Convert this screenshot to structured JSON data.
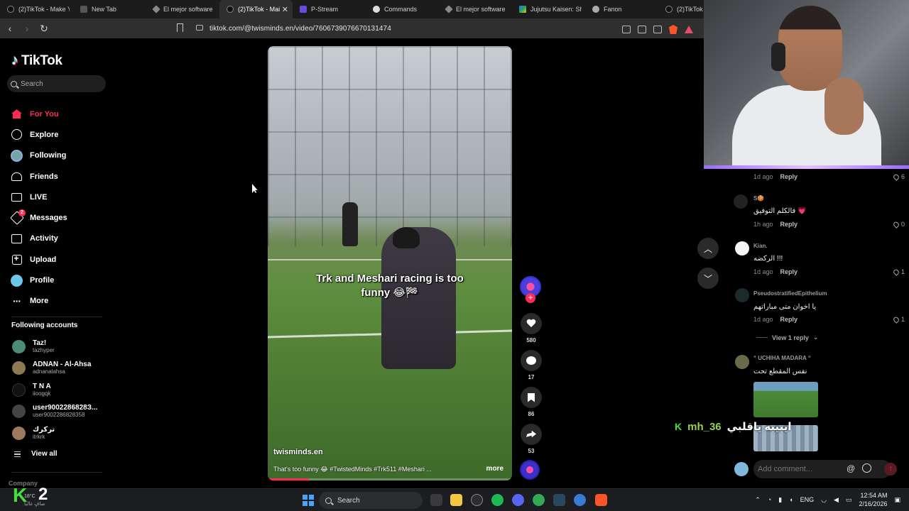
{
  "browser": {
    "tabs": [
      {
        "title": "(2)TikTok - Make Yo",
        "favicon": "tiktok-icon",
        "active": false
      },
      {
        "title": "New Tab",
        "favicon": "shield-icon",
        "active": false
      },
      {
        "title": "El mejor software p",
        "favicon": "diamond-icon",
        "active": false
      },
      {
        "title": "(2)TikTok - Mai",
        "favicon": "tiktok-icon",
        "active": true
      },
      {
        "title": "P-Stream",
        "favicon": "pstream-icon",
        "active": false
      },
      {
        "title": "Commands",
        "favicon": "discord-icon",
        "active": false
      },
      {
        "title": "El mejor software p",
        "favicon": "diamond-icon",
        "active": false
      },
      {
        "title": "Jujutsu Kaisen: Shin",
        "favicon": "drive-icon",
        "active": false
      },
      {
        "title": "Fanon",
        "favicon": "fanon-icon",
        "active": false
      },
      {
        "title": "(2)TikTok",
        "favicon": "tiktok-icon",
        "active": false
      }
    ],
    "url": "tiktok.com/@twisminds.en/video/7606739076670131474"
  },
  "sidebar": {
    "brand": "TikTok",
    "search_placeholder": "Search",
    "nav": [
      {
        "label": "For You",
        "icon": "home-icon",
        "active": true
      },
      {
        "label": "Explore",
        "icon": "compass-icon"
      },
      {
        "label": "Following",
        "icon": "following-avatar-icon"
      },
      {
        "label": "Friends",
        "icon": "friends-icon"
      },
      {
        "label": "LIVE",
        "icon": "live-icon"
      },
      {
        "label": "Messages",
        "icon": "messages-icon",
        "badge": "2"
      },
      {
        "label": "Activity",
        "icon": "activity-icon"
      },
      {
        "label": "Upload",
        "icon": "upload-icon"
      },
      {
        "label": "Profile",
        "icon": "profile-icon"
      },
      {
        "label": "More",
        "icon": "more-icon"
      }
    ],
    "following_title": "Following accounts",
    "accounts": [
      {
        "name": "Taz!",
        "handle": "tazhyper",
        "color": "#4a8c74"
      },
      {
        "name": "ADNAN - Al-Ahsa",
        "handle": "adnanalahsa",
        "color": "#8d7a52"
      },
      {
        "name": "T N A",
        "handle": "iioogqk",
        "color": "#111111"
      },
      {
        "name": "user9002286828З...",
        "handle": "user9002286828358",
        "color": "#444444"
      },
      {
        "name": "تركرك",
        "handle": "itrkrk",
        "color": "#9c7a5c"
      }
    ],
    "view_all": "View all",
    "company": "Company"
  },
  "video": {
    "caption": "Trk and Meshari racing is too funny 😂🏁",
    "author": "twisminds.en",
    "description": "That's too funny 😂 #TwistedMinds #Trk511 #Meshari ...",
    "more": "more",
    "progress": 0.17
  },
  "actions": {
    "likes": "580",
    "comments": "17",
    "saves": "86",
    "shares": "53"
  },
  "comments": {
    "items": [
      {
        "user": "",
        "text": "",
        "time": "1d ago",
        "reply": "Reply",
        "likes": "6"
      },
      {
        "user": "S🍪",
        "text": "فالكلم التوفيق 💗",
        "time": "1h ago",
        "reply": "Reply",
        "likes": "0"
      },
      {
        "user": "Kian.",
        "text": "الركضه !!!",
        "time": "1d ago",
        "reply": "Reply",
        "likes": "1"
      },
      {
        "user": "PseudostratifiedEpithelium",
        "text": "يا اخوان متى مباراتهم",
        "time": "1d ago",
        "reply": "Reply",
        "likes": "1"
      },
      {
        "user": "“ UCHIHA MADARA “",
        "text": "نفس المقطع تحت",
        "time": "",
        "reply": "",
        "likes": ""
      }
    ],
    "view_reply": "View 1 reply",
    "input_placeholder": "Add comment..."
  },
  "stream_chat": {
    "badge": "K",
    "user": "mh_36",
    "message": "ايبيبه ياقلبي"
  },
  "taskbar": {
    "search": "Search",
    "lang": "ENG",
    "time": "12:54 AM",
    "date": "2/16/2026",
    "weather_badge": "K",
    "weather_number": "2",
    "weather_temp": "18°C",
    "weather_desc": "صافٍ غالباً"
  }
}
